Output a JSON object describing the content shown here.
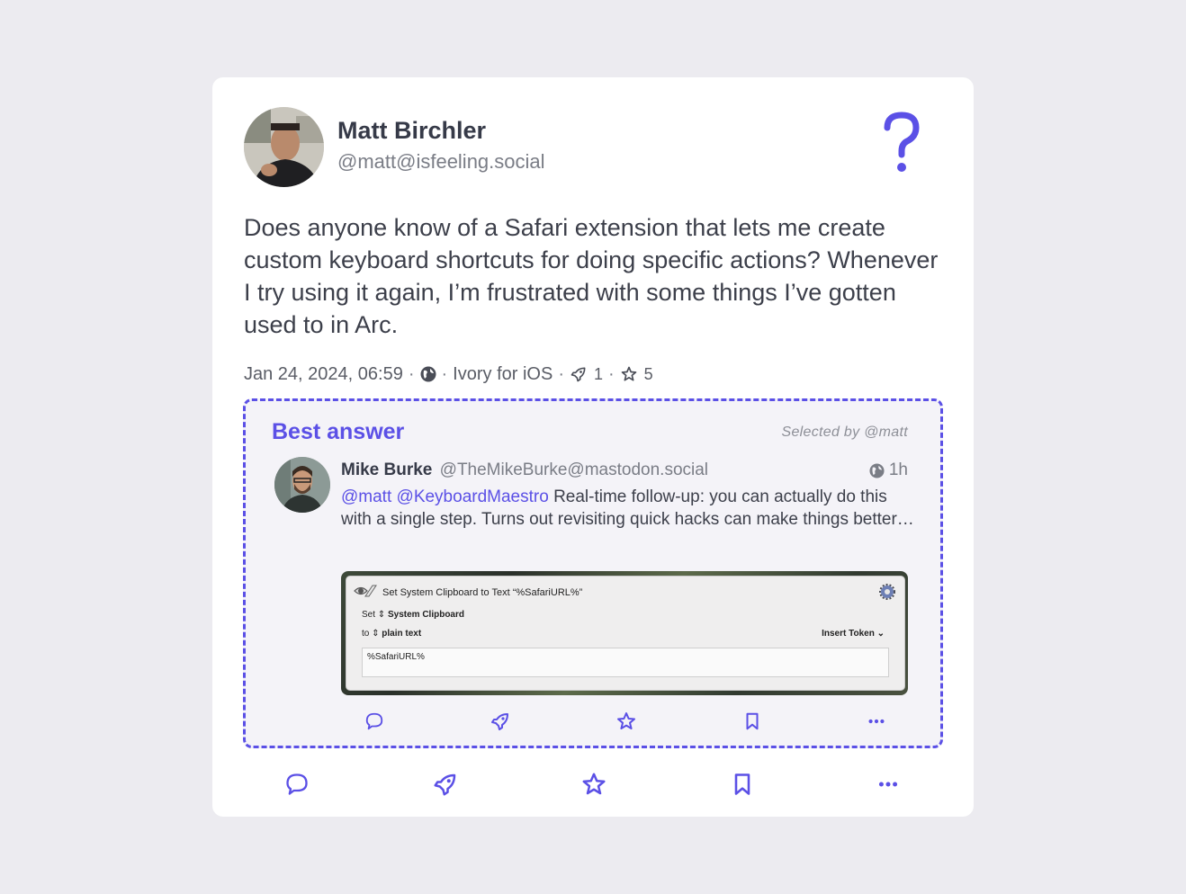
{
  "post": {
    "author_name": "Matt Birchler",
    "author_handle": "@matt@isfeeling.social",
    "body": "Does anyone know of a Safari extension that lets me create custom keyboard shortcuts for doing specific actions? Whenever I try using it again, I’m frustrated with some things I’ve gotten used to in Arc.",
    "timestamp": "Jan 24, 2024, 06:59",
    "client": "Ivory for iOS",
    "boosts": "1",
    "favorites": "5",
    "icon": "question-mark-icon"
  },
  "best_answer": {
    "title": "Best answer",
    "selected_by": "Selected by @matt",
    "reply": {
      "author_name": "Mike Burke",
      "author_handle": "@TheMikeBurke@mastodon.social",
      "time": "1h",
      "mention_1": "@matt",
      "mention_2": "@KeyboardMaestro",
      "text": " Real-time follow-up: you can actually do this with a single step. Turns out revisiting quick hacks can make things better…"
    },
    "attachment": {
      "title": "Set System Clipboard to Text “%SafariURL%”",
      "set_label": "Set",
      "set_value": "System Clipboard",
      "to_label": "to",
      "to_value": "plain text",
      "insert_token": "Insert Token",
      "field_value": "%SafariURL%"
    }
  },
  "colors": {
    "accent": "#5b50e6",
    "background": "#ecebf0",
    "card": "#ffffff",
    "best_answer_bg": "#f4f3f8"
  }
}
